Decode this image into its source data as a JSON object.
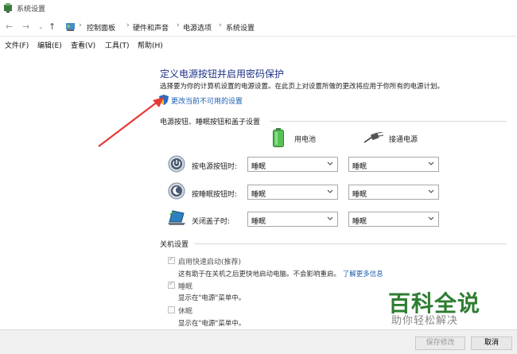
{
  "window": {
    "title": "系统设置"
  },
  "address": {
    "crumbs": [
      "控制面板",
      "硬件和声音",
      "电源选项",
      "系统设置"
    ]
  },
  "menu": [
    "文件(F)",
    "编辑(E)",
    "查看(V)",
    "工具(T)",
    "帮助(H)"
  ],
  "page": {
    "heading": "定义电源按钮并启用密码保护",
    "description": "选择要为你的计算机设置的电源设置。在此页上对设置所做的更改将应用于你所有的电源计划。",
    "change_link": "更改当前不可用的设置"
  },
  "power_section": {
    "title": "电源按钮、睡眠按钮和盖子设置",
    "columns": [
      "用电池",
      "接通电源"
    ],
    "rows": [
      {
        "label": "按电源按钮时:",
        "battery": "睡眠",
        "plugged": "睡眠",
        "icon": "power-button-icon"
      },
      {
        "label": "按睡眠按钮时:",
        "battery": "睡眠",
        "plugged": "睡眠",
        "icon": "sleep-button-icon"
      },
      {
        "label": "关闭盖子时:",
        "battery": "睡眠",
        "plugged": "睡眠",
        "icon": "laptop-lid-icon"
      }
    ]
  },
  "shutdown_section": {
    "title": "关机设置",
    "items": [
      {
        "label": "启用快速启动(推荐)",
        "checked": true,
        "desc": "这有助于在关机之后更快地启动电脑。不会影响重启。",
        "link": "了解更多信息"
      },
      {
        "label": "睡眠",
        "checked": true,
        "desc": "显示在\"电源\"菜单中。"
      },
      {
        "label": "休眠",
        "checked": false,
        "desc": "显示在\"电源\"菜单中。"
      }
    ]
  },
  "buttons": {
    "save": "保存修改",
    "cancel": "取消"
  },
  "watermark": {
    "big": "百科全说",
    "small": "助你轻松解决"
  },
  "colors": {
    "heading": "#1e3287",
    "link": "#1a5fb4",
    "annotation_arrow": "#e53935",
    "watermark": "#2e7d32"
  }
}
